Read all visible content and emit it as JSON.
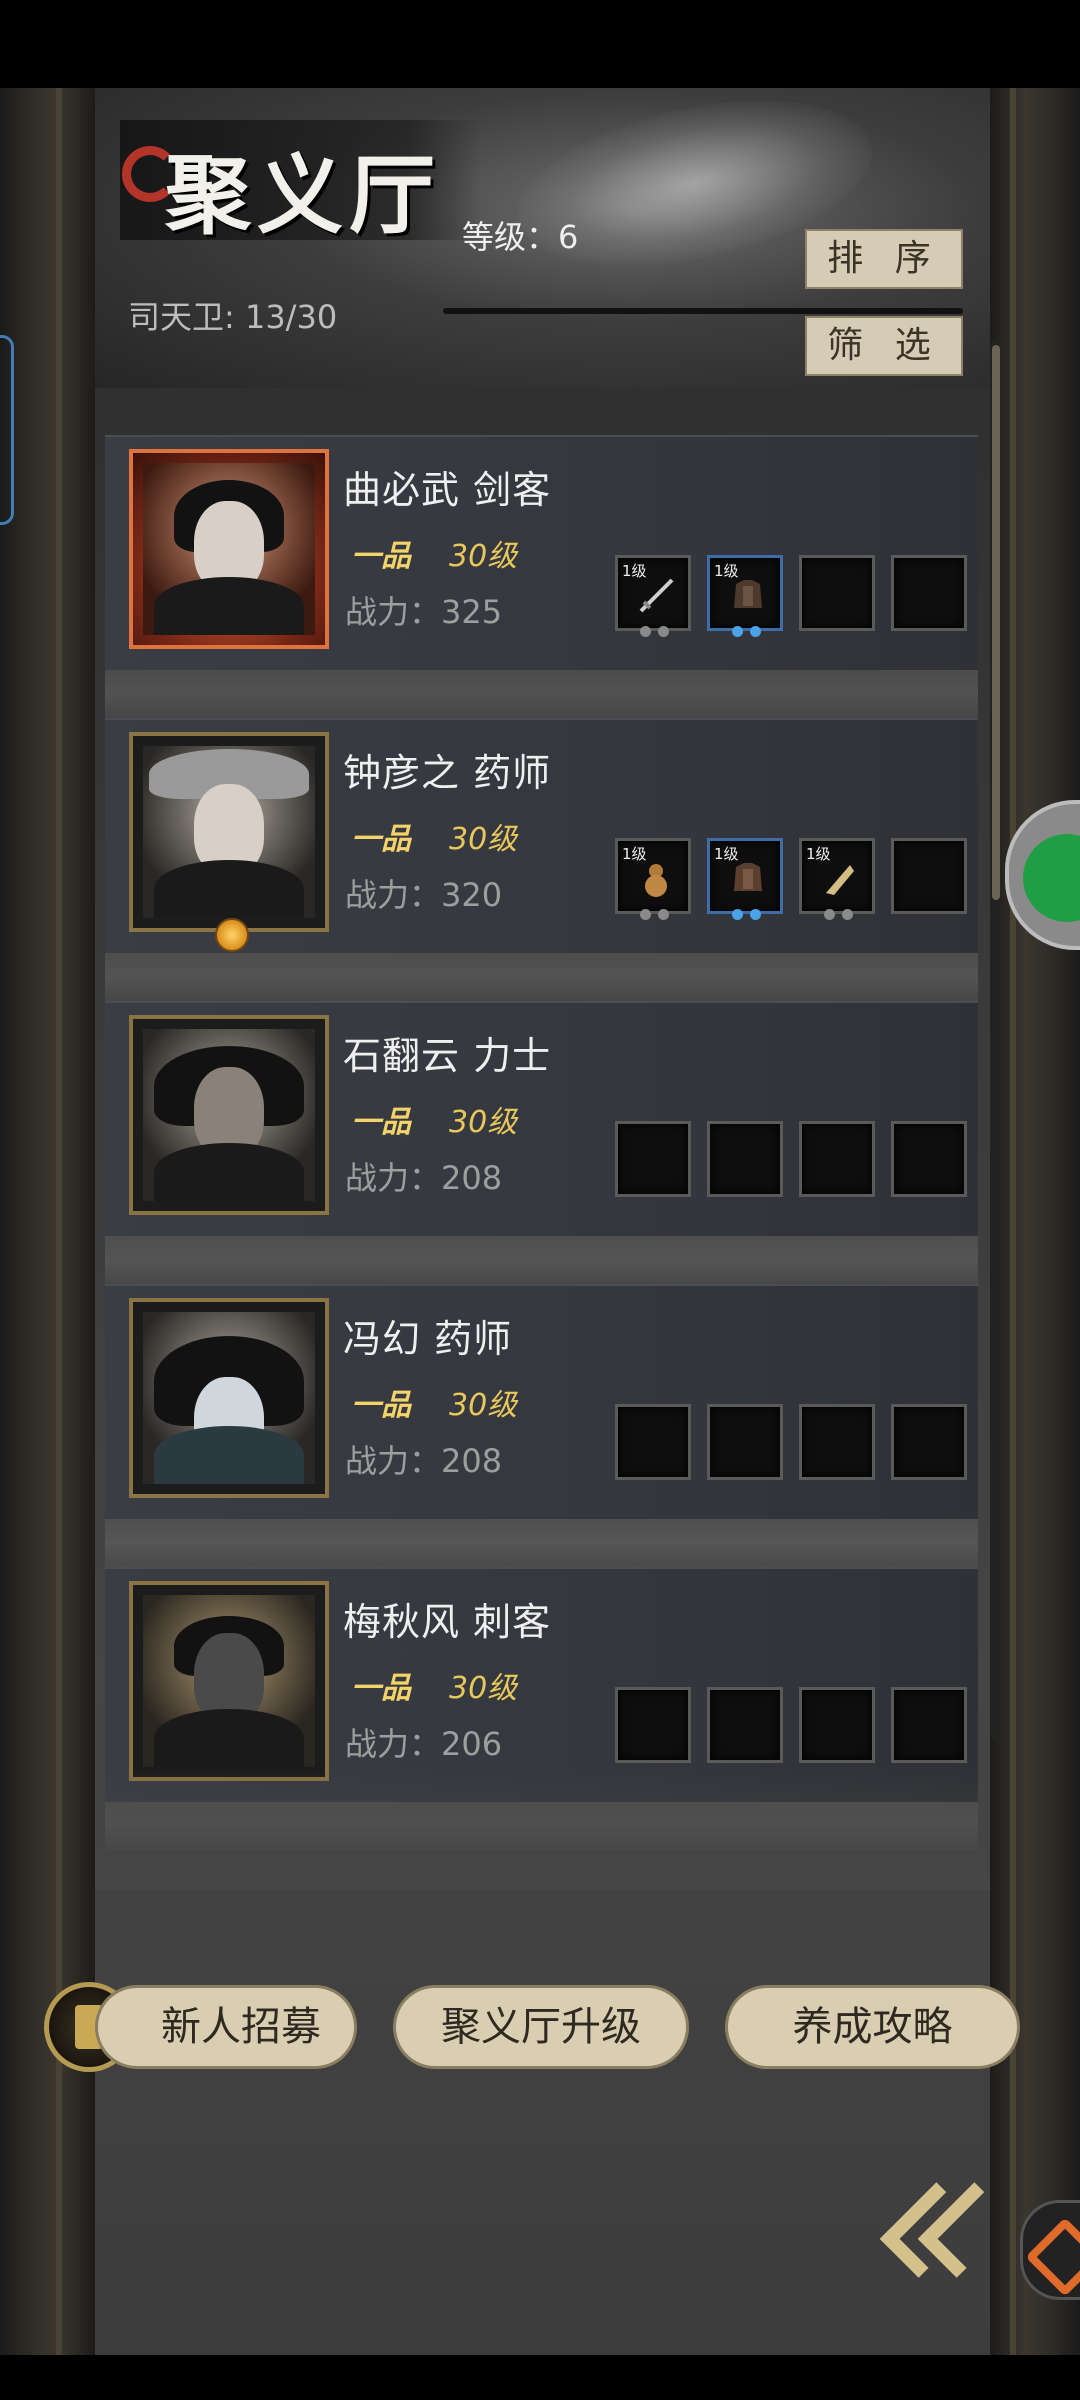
{
  "header": {
    "title": "聚义厅",
    "level_text": "等级：6",
    "sort_label": "排 序",
    "filter_label": "筛 选",
    "capacity": "司天卫: 13/30"
  },
  "heroes": [
    {
      "name": "曲必武   剑客",
      "rank": "一品",
      "level": "30级",
      "power": "战力：325",
      "slots": [
        {
          "level": "1级",
          "icon": "sword-icon"
        },
        {
          "level": "1级",
          "icon": "armor-icon"
        },
        {
          "level": "",
          "icon": "empty-slot"
        },
        {
          "level": "",
          "icon": "empty-slot"
        }
      ]
    },
    {
      "name": "钟彦之   药师",
      "rank": "一品",
      "level": "30级",
      "power": "战力：320",
      "slots": [
        {
          "level": "1级",
          "icon": "gourd-icon"
        },
        {
          "level": "1级",
          "icon": "armor-icon"
        },
        {
          "level": "1级",
          "icon": "horn-icon"
        },
        {
          "level": "",
          "icon": "empty-slot"
        }
      ]
    },
    {
      "name": "石翻云   力士",
      "rank": "一品",
      "level": "30级",
      "power": "战力：208",
      "slots": [
        {
          "level": "",
          "icon": "empty-slot"
        },
        {
          "level": "",
          "icon": "empty-slot"
        },
        {
          "level": "",
          "icon": "empty-slot"
        },
        {
          "level": "",
          "icon": "empty-slot"
        }
      ]
    },
    {
      "name": "冯幻   药师",
      "rank": "一品",
      "level": "30级",
      "power": "战力：208",
      "slots": [
        {
          "level": "",
          "icon": "empty-slot"
        },
        {
          "level": "",
          "icon": "empty-slot"
        },
        {
          "level": "",
          "icon": "empty-slot"
        },
        {
          "level": "",
          "icon": "empty-slot"
        }
      ]
    },
    {
      "name": "梅秋风   刺客",
      "rank": "一品",
      "level": "30级",
      "power": "战力：206",
      "slots": [
        {
          "level": "",
          "icon": "empty-slot"
        },
        {
          "level": "",
          "icon": "empty-slot"
        },
        {
          "level": "",
          "icon": "empty-slot"
        },
        {
          "level": "",
          "icon": "empty-slot"
        }
      ]
    }
  ],
  "footer": {
    "recruit_label": "新人招募",
    "upgrade_label": "聚义厅升级",
    "guide_label": "养成攻略"
  },
  "colors": {
    "rank_gold": "#f3d36a",
    "button_beige": "#d9ceb2",
    "frame_gold": "#8a7444"
  }
}
